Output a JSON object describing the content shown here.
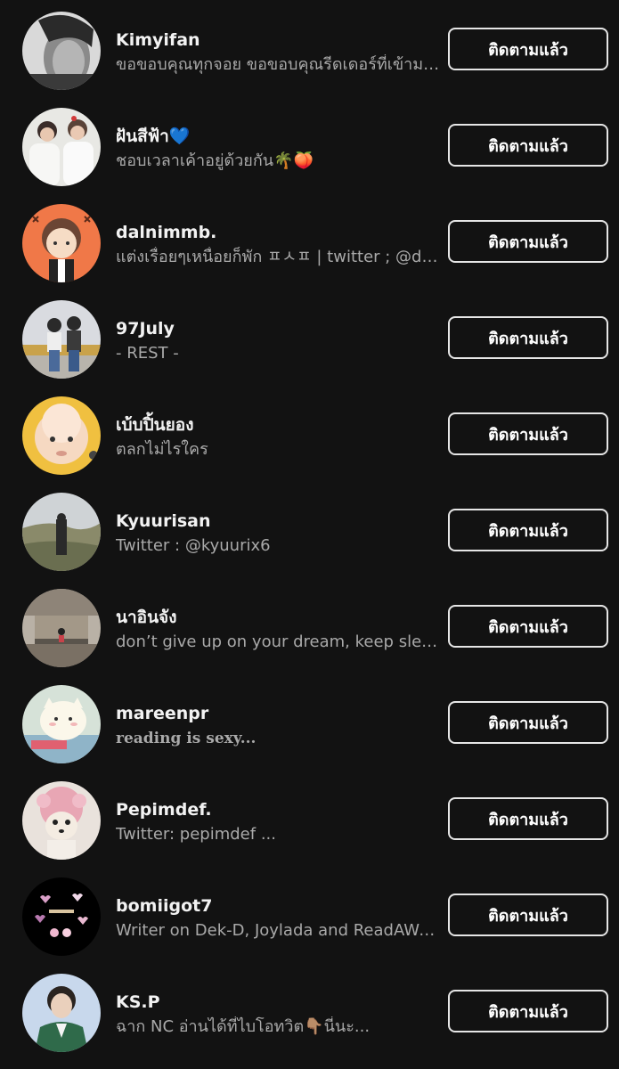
{
  "follow_label": "ติดตามแล้ว",
  "users": [
    {
      "name": "Kimyifan",
      "bio": "ขอขอบคุณทุกจอย ขอขอบคุณรีดเดอร์ที่เข้ามาอ่าน"
    },
    {
      "name": "ฝันสีฟ้า💙",
      "bio": "ชอบเวลาเค้าอยู่ด้วยกัน🌴🍑"
    },
    {
      "name": "dalnimmb.",
      "bio": "แต่งเรื่อยๆเหนื่อยก็พัก ㅍㅅㅍ | twitter ; @dalnimmb"
    },
    {
      "name": "97July",
      "bio": "- REST -"
    },
    {
      "name": "เบ้บปิ้นยอง",
      "bio": "ตลกไม่ไรใคร"
    },
    {
      "name": "Kyuurisan",
      "bio": "Twitter : @kyuurix6"
    },
    {
      "name": "นาอินจัง",
      "bio": "don’t give up on your dream, keep sleeping"
    },
    {
      "name": "mareenpr",
      "bio": "reading is sexy..."
    },
    {
      "name": "Pepimdef.",
      "bio": "Twitter: pepimdef ..."
    },
    {
      "name": "bomiigot7",
      "bio": "Writer on Dek-D, Joylada and ReadAWrite"
    },
    {
      "name": "KS.P",
      "bio": "ฉาก NC อ่านได้ที่ไบโอทวิต👇🏽นี่นะ..."
    }
  ]
}
